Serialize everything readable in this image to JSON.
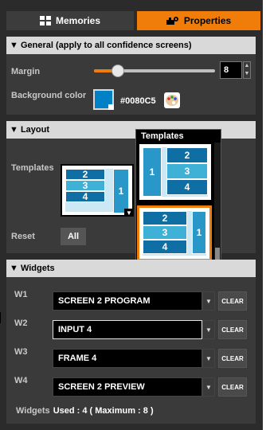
{
  "tabs": {
    "memories_label": "Memories",
    "properties_label": "Properties",
    "active": "Properties"
  },
  "general": {
    "header": "▼ General (apply to all confidence screens)",
    "margin_label": "Margin",
    "margin_value": "8",
    "margin_level_fraction": 0.2,
    "bg_color_label": "Background color",
    "bg_color_hex": "#0080C5",
    "bg_color": "#0080c5"
  },
  "layout": {
    "header": "▼ Layout",
    "templates_label": "Templates",
    "reset_label": "Reset",
    "all_button": "All",
    "popup_title": "Templates",
    "current_template_cells": [
      "2",
      "3",
      "4",
      "1"
    ],
    "popup_templates": [
      {
        "cells": [
          "1",
          "2",
          "3",
          "4"
        ],
        "selected": false
      },
      {
        "cells": [
          "2",
          "3",
          "4",
          "1"
        ],
        "selected": true
      }
    ]
  },
  "widgets": {
    "header": "▼ Widgets",
    "rows": [
      {
        "label": "W1",
        "value": "SCREEN 2 PROGRAM",
        "clear": "CLEAR"
      },
      {
        "label": "W2",
        "value": "INPUT 4",
        "clear": "CLEAR"
      },
      {
        "label": "W3",
        "value": "FRAME 4",
        "clear": "CLEAR"
      },
      {
        "label": "W4",
        "value": "SCREEN 2 PREVIEW",
        "clear": "CLEAR"
      }
    ],
    "summary_label": "Widgets",
    "summary_value": "Used : 4 ( Maximum : 8 )"
  },
  "colors": {
    "accent": "#f07d0a",
    "panel": "#3a3a3a",
    "header_bg": "#d9d9d9"
  },
  "icons": {
    "memories": "grid-icon",
    "properties": "settings-tools-icon",
    "palette": "color-palette-icon"
  }
}
